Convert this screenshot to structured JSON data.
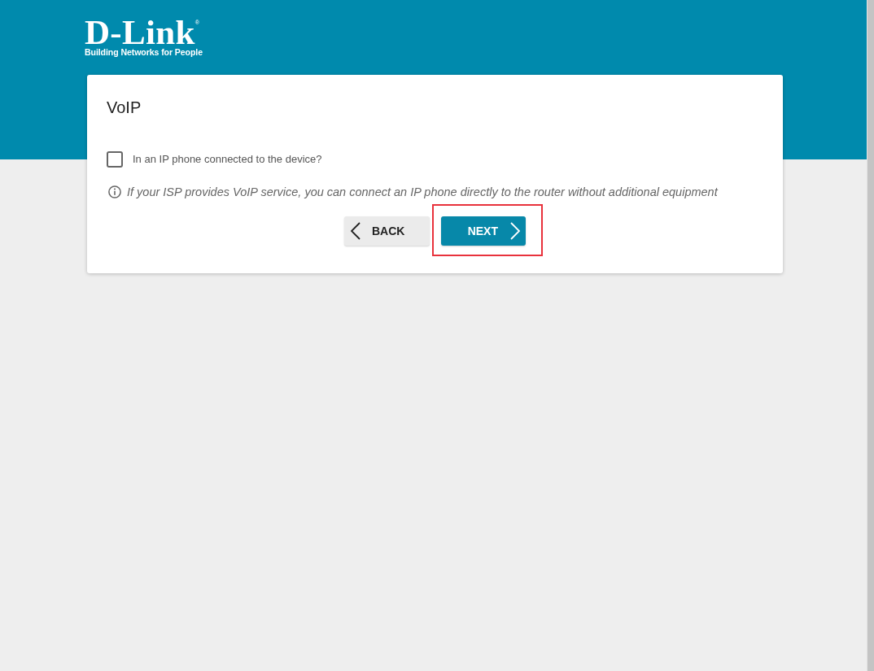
{
  "header": {
    "logo": {
      "wordmark": "D-Link",
      "registered_mark": "®",
      "tagline": "Building Networks for People"
    }
  },
  "card": {
    "title": "VoIP",
    "question": {
      "label": "In an IP phone connected to the device?",
      "checked": false
    },
    "hint": "If your ISP provides VoIP service, you can connect an IP phone directly to the router without additional equipment",
    "buttons": [
      {
        "label": "BACK",
        "kind": "back",
        "highlighted": false
      },
      {
        "label": "NEXT",
        "kind": "next",
        "highlighted": true
      }
    ]
  }
}
